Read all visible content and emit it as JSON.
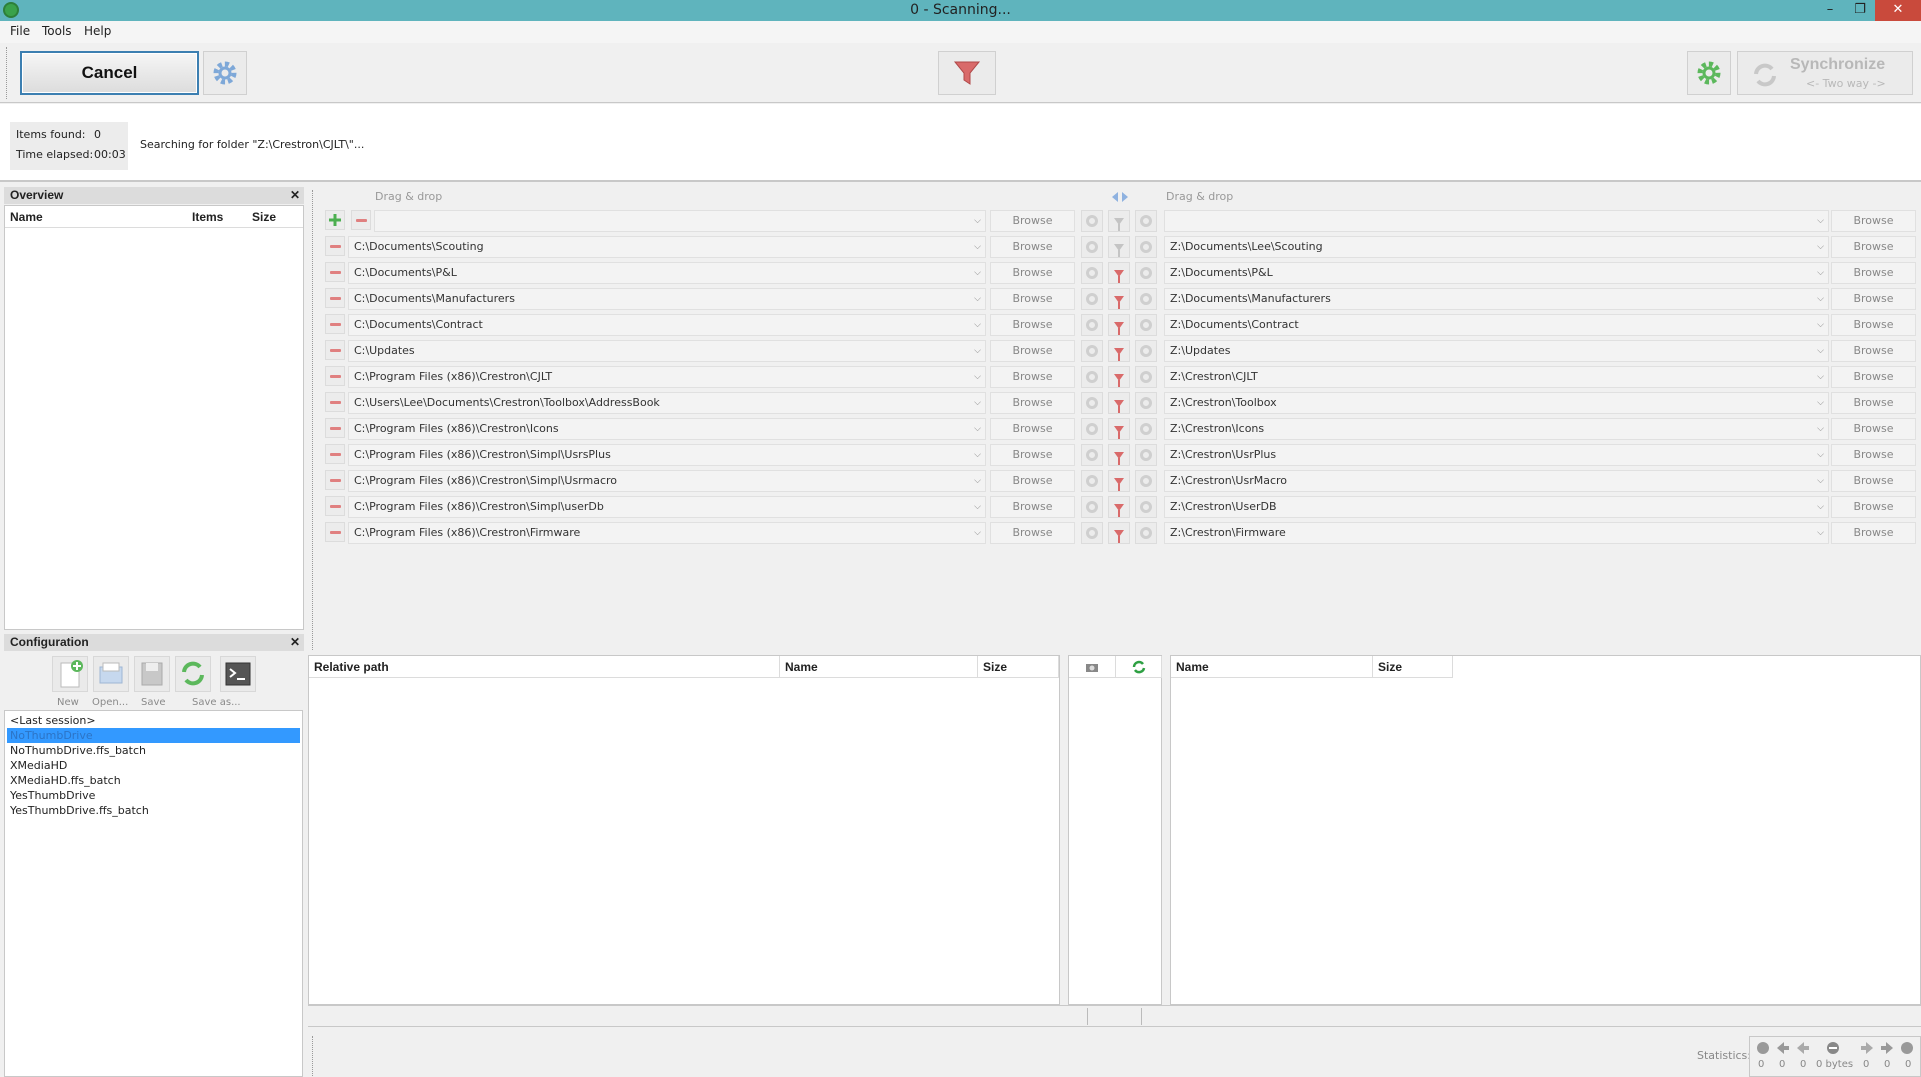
{
  "window": {
    "title": "0 - Scanning...",
    "minimize": "–",
    "restore": "❐",
    "close": "✕"
  },
  "menu": [
    "File",
    "Tools",
    "Help"
  ],
  "toolbar": {
    "cancel_label": "Cancel",
    "sync_label": "Synchronize",
    "sync_mode": "<- Two way ->"
  },
  "status": {
    "items_found_label": "Items found:",
    "items_found_value": "0",
    "time_elapsed_label": "Time elapsed:",
    "time_elapsed_value": "00:03",
    "message": "Searching for folder \"Z:\\Crestron\\CJLT\\\"..."
  },
  "overview": {
    "title": "Overview",
    "close": "✕",
    "columns": [
      "Name",
      "Items",
      "Size"
    ]
  },
  "configuration": {
    "title": "Configuration",
    "close": "✕",
    "tools": [
      "New",
      "Open...",
      "Save",
      "Save as..."
    ],
    "items": [
      "<Last session>",
      "NoThumbDrive",
      "NoThumbDrive.ffs_batch",
      "XMediaHD",
      "XMediaHD.ffs_batch",
      "YesThumbDrive",
      "YesThumbDrive.ffs_batch"
    ],
    "selected_index": 1
  },
  "folder_pairs": {
    "drag_drop_left": "Drag & drop",
    "drag_drop_right": "Drag & drop",
    "browse_label": "Browse",
    "left": [
      "",
      "C:\\Documents\\Scouting",
      "C:\\Documents\\P&L",
      "C:\\Documents\\Manufacturers",
      "C:\\Documents\\Contract",
      "C:\\Updates",
      "C:\\Program Files (x86)\\Crestron\\CJLT",
      "C:\\Users\\Lee\\Documents\\Crestron\\Toolbox\\AddressBook",
      "C:\\Program Files (x86)\\Crestron\\Icons",
      "C:\\Program Files (x86)\\Crestron\\Simpl\\UsrsPlus",
      "C:\\Program Files (x86)\\Crestron\\Simpl\\Usrmacro",
      "C:\\Program Files (x86)\\Crestron\\Simpl\\userDb",
      "C:\\Program Files (x86)\\Crestron\\Firmware"
    ],
    "right": [
      "",
      "Z:\\Documents\\Lee\\Scouting",
      "Z:\\Documents\\P&L",
      "Z:\\Documents\\Manufacturers",
      "Z:\\Documents\\Contract",
      "Z:\\Updates",
      "Z:\\Crestron\\CJLT",
      "Z:\\Crestron\\Toolbox",
      "Z:\\Crestron\\Icons",
      "Z:\\Crestron\\UsrPlus",
      "Z:\\Crestron\\UsrMacro",
      "Z:\\Crestron\\UserDB",
      "Z:\\Crestron\\Firmware"
    ]
  },
  "grid": {
    "left_columns": [
      "Relative path",
      "Name",
      "Size"
    ],
    "right_columns": [
      "Name",
      "Size"
    ]
  },
  "statistics": {
    "label": "Statistics:",
    "values": [
      "0",
      "0",
      "0",
      "0 bytes",
      "0",
      "0",
      "0"
    ]
  },
  "colors": {
    "titlebar": "#5fb4bd",
    "accent": "#3399ff",
    "close": "#c94a3c"
  }
}
